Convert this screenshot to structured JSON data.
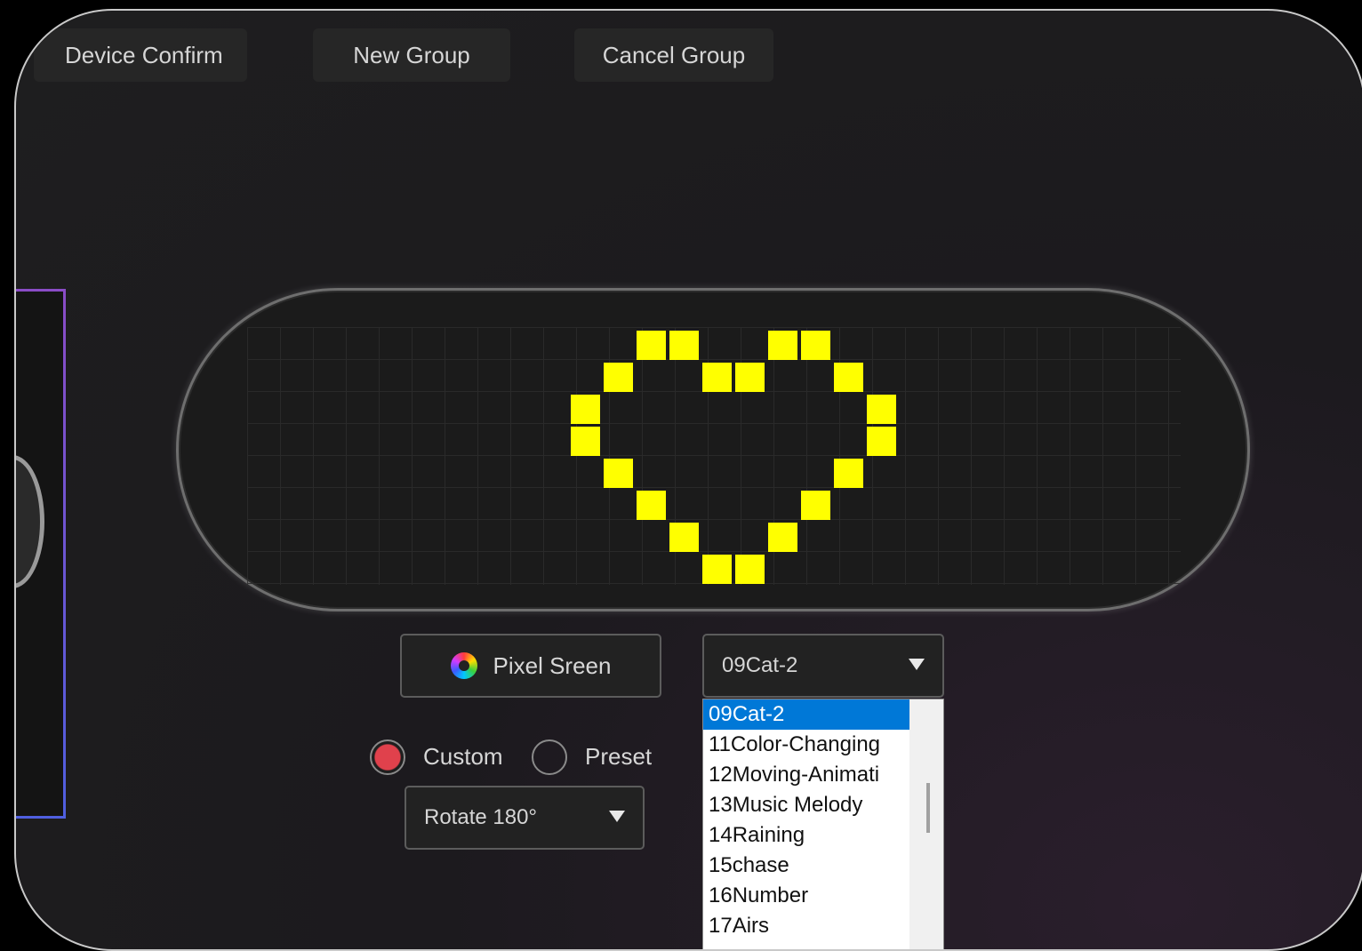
{
  "toolbar": {
    "device_confirm": "Device Confirm",
    "new_group": "New Group",
    "cancel_group": "Cancel Group"
  },
  "display": {
    "pixel_color": "#ffff00",
    "lit_pixels": [
      [
        9,
        0
      ],
      [
        10,
        0
      ],
      [
        13,
        0
      ],
      [
        14,
        0
      ],
      [
        8,
        1
      ],
      [
        11,
        1
      ],
      [
        12,
        1
      ],
      [
        15,
        1
      ],
      [
        7,
        2
      ],
      [
        16,
        2
      ],
      [
        7,
        3
      ],
      [
        16,
        3
      ],
      [
        8,
        4
      ],
      [
        15,
        4
      ],
      [
        9,
        5
      ],
      [
        14,
        5
      ],
      [
        10,
        6
      ],
      [
        13,
        6
      ],
      [
        11,
        7
      ],
      [
        12,
        7
      ]
    ]
  },
  "controls": {
    "pixel_screen_label": "Pixel Sreen",
    "mode": {
      "custom_label": "Custom",
      "preset_label": "Preset",
      "selected": "Custom"
    },
    "rotate_value": "Rotate 180°",
    "animation_value": "09Cat-2",
    "animation_options": [
      "09Cat-2",
      "11Color-Changing",
      "12Moving-Animati",
      "13Music Melody",
      "14Raining",
      "15chase",
      "16Number",
      "17Airs"
    ],
    "selected_option": "09Cat-2"
  },
  "colors": {
    "accent_radio": "#e0414c",
    "selection_highlight": "#0078d7"
  }
}
